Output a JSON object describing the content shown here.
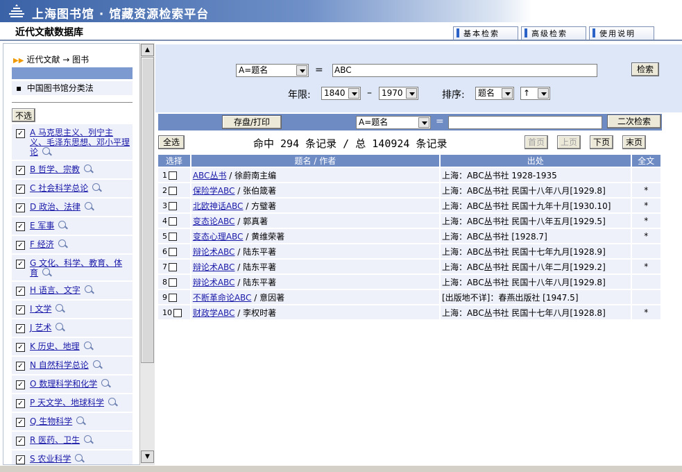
{
  "header": {
    "site_title": "上海图书馆 · 馆藏资源检索平台",
    "db_title": "近代文献数据库",
    "tabs": [
      "基本检索",
      "高级检索",
      "使用说明"
    ]
  },
  "sidebar": {
    "breadcrumb": "近代文献 → 图书",
    "classification": "中国图书馆分类法",
    "deselect_label": "不选",
    "categories": [
      {
        "label": "A 马克思主义、列宁主义、毛泽东思想、邓小平理论",
        "checked": true
      },
      {
        "label": "B 哲学、宗教",
        "checked": true
      },
      {
        "label": "C 社会科学总论",
        "checked": true
      },
      {
        "label": "D 政治、法律",
        "checked": true
      },
      {
        "label": "E 军事",
        "checked": true
      },
      {
        "label": "F 经济",
        "checked": true
      },
      {
        "label": "G 文化、科学、教育、体育",
        "checked": true
      },
      {
        "label": "H 语言、文字",
        "checked": true
      },
      {
        "label": "I 文学",
        "checked": true
      },
      {
        "label": "J 艺术",
        "checked": true
      },
      {
        "label": "K 历史、地理",
        "checked": true
      },
      {
        "label": "N 自然科学总论",
        "checked": true
      },
      {
        "label": "O 数理科学和化学",
        "checked": true
      },
      {
        "label": "P 天文学、地球科学",
        "checked": true
      },
      {
        "label": "Q 生物科学",
        "checked": true
      },
      {
        "label": "R 医药、卫生",
        "checked": true
      },
      {
        "label": "S 农业科学",
        "checked": true
      }
    ]
  },
  "search": {
    "field": "A=题名",
    "eq": "=",
    "query": "ABC",
    "search_button": "检索",
    "year_label": "年限:",
    "year_from": "1840",
    "year_dash": "–",
    "year_to": "1970",
    "sort_label": "排序:",
    "sort_field": "题名",
    "sort_order": "↑"
  },
  "toolbar2": {
    "save_print": "存盘/打印",
    "field": "A=题名",
    "eq": "=",
    "query": "",
    "secondary_search": "二次检索"
  },
  "results_bar": {
    "select_all": "全选",
    "summary": "命中 294 条记录 / 总 140924 条记录",
    "first": "首页",
    "prev": "上页",
    "next": "下页",
    "last": "末页"
  },
  "table": {
    "headers": [
      "选择",
      "题名 / 作者",
      "出处",
      "全文"
    ],
    "rows": [
      {
        "n": "1",
        "title": "ABC丛书",
        "author": " / 徐蔚南主编",
        "source": "上海：ABC丛书社 1928-1935",
        "full": ""
      },
      {
        "n": "2",
        "title": "保险学ABC",
        "author": " / 张伯箴著",
        "source": "上海：ABC丛书社 民国十八年八月[1929.8]",
        "full": "*"
      },
      {
        "n": "3",
        "title": "北欧神话ABC",
        "author": " / 方璧著",
        "source": "上海：ABC丛书社 民国十九年十月[1930.10]",
        "full": "*"
      },
      {
        "n": "4",
        "title": "变态论ABC",
        "author": " / 郭真著",
        "source": "上海：ABC丛书社 民国十八年五月[1929.5]",
        "full": "*"
      },
      {
        "n": "5",
        "title": "变态心理ABC",
        "author": " / 黄维荣著",
        "source": "上海：ABC丛书社 [1928.7]",
        "full": "*"
      },
      {
        "n": "6",
        "title": "辩论术ABC",
        "author": " / 陆东平著",
        "source": "上海：ABC丛书社 民国十七年九月[1928.9]",
        "full": ""
      },
      {
        "n": "7",
        "title": "辩论术ABC",
        "author": " / 陆东平著",
        "source": "上海：ABC丛书社 民国十八年二月[1929.2]",
        "full": "*"
      },
      {
        "n": "8",
        "title": "辩论术ABC",
        "author": " / 陆东平著",
        "source": "上海：ABC丛书社 民国十八年八月[1929.8]",
        "full": ""
      },
      {
        "n": "9",
        "title": "不断革命论ABC",
        "author": " / 意因著",
        "source": "[出版地不详]：春燕出版社 [1947.5]",
        "full": ""
      },
      {
        "n": "10",
        "title": "财政学ABC",
        "author": " / 李权时著",
        "source": "上海：ABC丛书社 民国十七年八月[1928.8]",
        "full": "*"
      }
    ]
  }
}
